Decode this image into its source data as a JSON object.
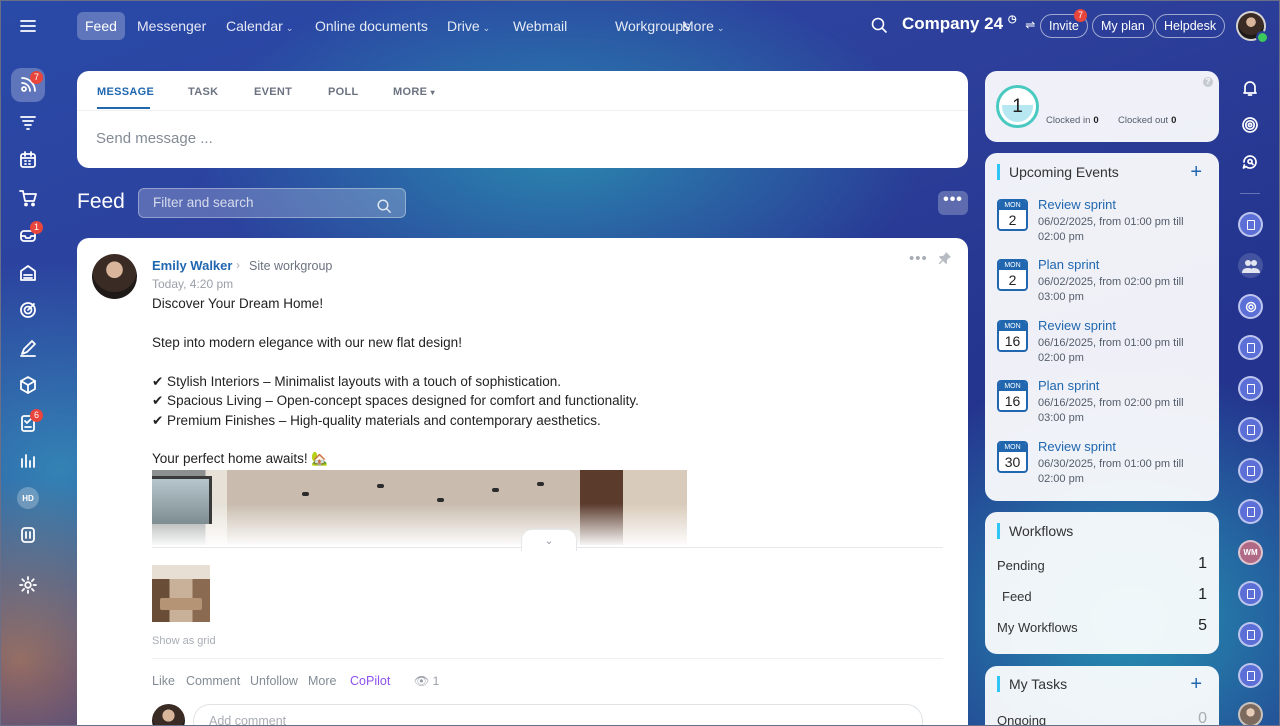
{
  "left_sidebar": {
    "badges": {
      "feed": "7",
      "inbox": "1",
      "tasks": "6"
    },
    "hd_label": "HD"
  },
  "topnav": {
    "items": [
      "Feed",
      "Messenger",
      "Calendar",
      "Online documents",
      "Drive",
      "Webmail",
      "Workgroups",
      "More"
    ],
    "company": "Company 24",
    "invite": "Invite",
    "invite_badge": "7",
    "my_plan": "My plan",
    "helpdesk": "Helpdesk"
  },
  "composer": {
    "tabs": [
      "MESSAGE",
      "TASK",
      "EVENT",
      "POLL",
      "MORE"
    ],
    "placeholder": "Send message ..."
  },
  "feed": {
    "title": "Feed",
    "filter_placeholder": "Filter and search"
  },
  "post": {
    "author": "Emily Walker",
    "target": "Site workgroup",
    "time": "Today, 4:20 pm",
    "lines": [
      "Discover Your Dream Home!",
      "Step into modern elegance with our new flat design!",
      "✔ Stylish Interiors – Minimalist layouts with a touch of sophistication.",
      "✔ Spacious Living – Open-concept spaces designed for comfort and functionality.",
      "✔ Premium Finishes – High-quality materials and contemporary aesthetics.",
      "Your perfect home awaits! 🏡"
    ],
    "show_as_grid": "Show as grid",
    "actions": [
      "Like",
      "Comment",
      "Unfollow",
      "More",
      "CoPilot"
    ],
    "views": "1",
    "comment_placeholder": "Add comment"
  },
  "clock": {
    "value": "1",
    "clocked_in_label": "Clocked in",
    "clocked_in": "0",
    "clocked_out_label": "Clocked out",
    "clocked_out": "0",
    "help": "?"
  },
  "events": {
    "title": "Upcoming Events",
    "items": [
      {
        "mon": "MON",
        "day": "2",
        "title": "Review sprint",
        "when": "06/02/2025, from 01:00 pm till 02:00 pm"
      },
      {
        "mon": "MON",
        "day": "2",
        "title": "Plan sprint",
        "when": "06/02/2025, from 02:00 pm till 03:00 pm"
      },
      {
        "mon": "MON",
        "day": "16",
        "title": "Review sprint",
        "when": "06/16/2025, from 01:00 pm till 02:00 pm"
      },
      {
        "mon": "MON",
        "day": "16",
        "title": "Plan sprint",
        "when": "06/16/2025, from 02:00 pm till 03:00 pm"
      },
      {
        "mon": "MON",
        "day": "30",
        "title": "Review sprint",
        "when": "06/30/2025, from 01:00 pm till 02:00 pm"
      }
    ]
  },
  "workflows": {
    "title": "Workflows",
    "rows": [
      {
        "label": "Pending",
        "count": "1"
      },
      {
        "label": "Feed",
        "count": "1"
      },
      {
        "label": "My Workflows",
        "count": "5"
      }
    ]
  },
  "tasks": {
    "title": "My Tasks",
    "rows": [
      {
        "label": "Ongoing",
        "count": "0"
      }
    ]
  },
  "right_sidebar": {
    "wm_initials": "WM"
  },
  "colors": {
    "accent": "#2067b0",
    "badge": "#e8453c",
    "copilot": "#8e52ec"
  }
}
